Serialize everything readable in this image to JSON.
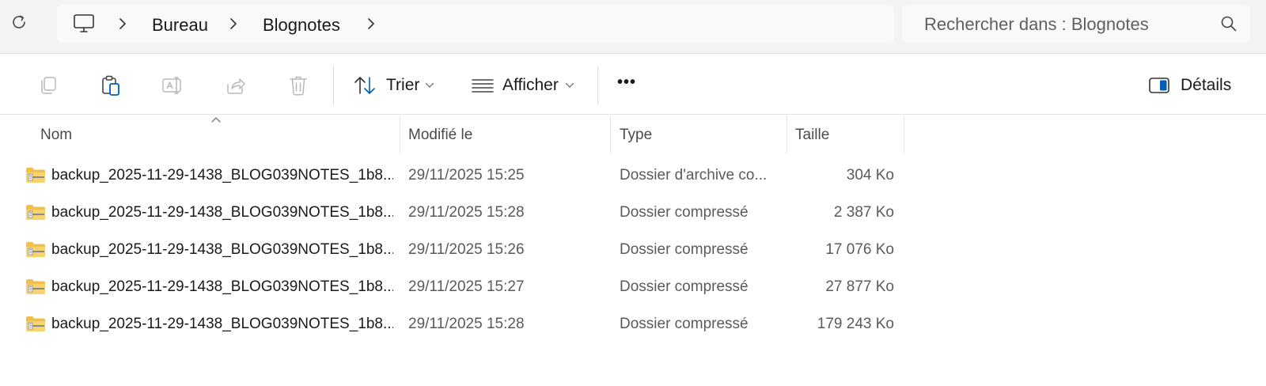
{
  "address": {
    "crumbs": [
      "Bureau",
      "Blognotes"
    ],
    "search_placeholder": "Rechercher dans : Blognotes"
  },
  "toolbar": {
    "icons": [
      "copy-icon",
      "paste-icon",
      "rename-icon",
      "share-icon",
      "delete-icon"
    ],
    "sort_label": "Trier",
    "view_label": "Afficher",
    "more_label": "•••",
    "details_label": "Détails"
  },
  "columns": {
    "name": "Nom",
    "modified": "Modifié le",
    "type": "Type",
    "size": "Taille"
  },
  "files": [
    {
      "name": "backup_2025-11-29-1438_BLOG039NOTES_1b8...",
      "modified": "29/11/2025 15:25",
      "type": "Dossier d'archive co...",
      "size": "304 Ko"
    },
    {
      "name": "backup_2025-11-29-1438_BLOG039NOTES_1b8...",
      "modified": "29/11/2025 15:28",
      "type": "Dossier compressé",
      "size": "2 387 Ko"
    },
    {
      "name": "backup_2025-11-29-1438_BLOG039NOTES_1b8...",
      "modified": "29/11/2025 15:26",
      "type": "Dossier compressé",
      "size": "17 076 Ko"
    },
    {
      "name": "backup_2025-11-29-1438_BLOG039NOTES_1b8...",
      "modified": "29/11/2025 15:27",
      "type": "Dossier compressé",
      "size": "27 877 Ko"
    },
    {
      "name": "backup_2025-11-29-1438_BLOG039NOTES_1b8...",
      "modified": "29/11/2025 15:28",
      "type": "Dossier compressé",
      "size": "179 243 Ko"
    }
  ],
  "colors": {
    "accent": "#005fb8",
    "folder_yellow": "#f2c04a",
    "disabled_icon": "#b8b8b8"
  }
}
